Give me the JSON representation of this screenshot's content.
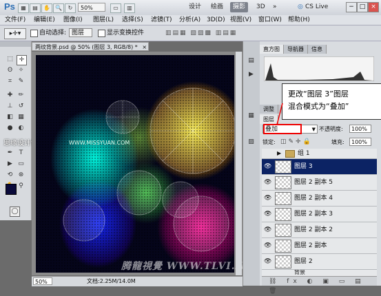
{
  "app": {
    "logo": "Ps",
    "zoom": "50%"
  },
  "workspace": {
    "items": [
      "设计",
      "绘画",
      "摄影",
      "3D",
      "»"
    ],
    "active": "摄影",
    "cslive": "CS Live"
  },
  "titlebar_icons": [
    "▦",
    "▤",
    "✋",
    "🔍",
    "↻",
    "▭",
    "▥"
  ],
  "window_controls": [
    "−",
    "□",
    "×"
  ],
  "menu": [
    "文件(F)",
    "编辑(E)",
    "图像(I)",
    "图层(L)",
    "选择(S)",
    "滤镜(T)",
    "分析(A)",
    "3D(D)",
    "视图(V)",
    "窗口(W)",
    "帮助(H)"
  ],
  "options": {
    "auto_select_label": "自动选择:",
    "auto_select_value": "图层",
    "show_transform": "显示变换控件"
  },
  "document": {
    "tab": "两纹背景.psd @ 50% (图层 3, RGB/8) *",
    "close": "×",
    "status_zoom": "50%",
    "status_info": "文档:2.25M/14.0M"
  },
  "panels": {
    "top_tabs": [
      "直方图",
      "导航器",
      "信息"
    ],
    "layer_tabs": [
      "调整",
      "蒙版"
    ],
    "layers_title": "图层",
    "blend_mode": "叠加",
    "opacity_label": "不透明度:",
    "opacity_value": "100%",
    "lock_label": "锁定:",
    "fill_label": "填充:",
    "fill_value": "100%",
    "layers": [
      {
        "name": "组 1",
        "type": "group"
      },
      {
        "name": "图层 3",
        "selected": true
      },
      {
        "name": "图层 2 副本 5"
      },
      {
        "name": "图层 2 副本 4"
      },
      {
        "name": "图层 2 副本 3"
      },
      {
        "name": "图层 2 副本 2"
      },
      {
        "name": "图层 2 副本"
      },
      {
        "name": "图层 2"
      },
      {
        "name": "背景"
      }
    ]
  },
  "callout": {
    "line1": "更改“图层 3”图层",
    "line2": "混合模式为“叠加”"
  },
  "watermarks": {
    "left": "思缘设计论坛",
    "url": "WWW.MISSYUAN.COM",
    "bottom": "腾龍視覺 WWW.TLVI.NET"
  },
  "colors": {
    "foreground": "#0a0a3a",
    "background": "#ffffff",
    "selected_layer": "#0c2364"
  }
}
